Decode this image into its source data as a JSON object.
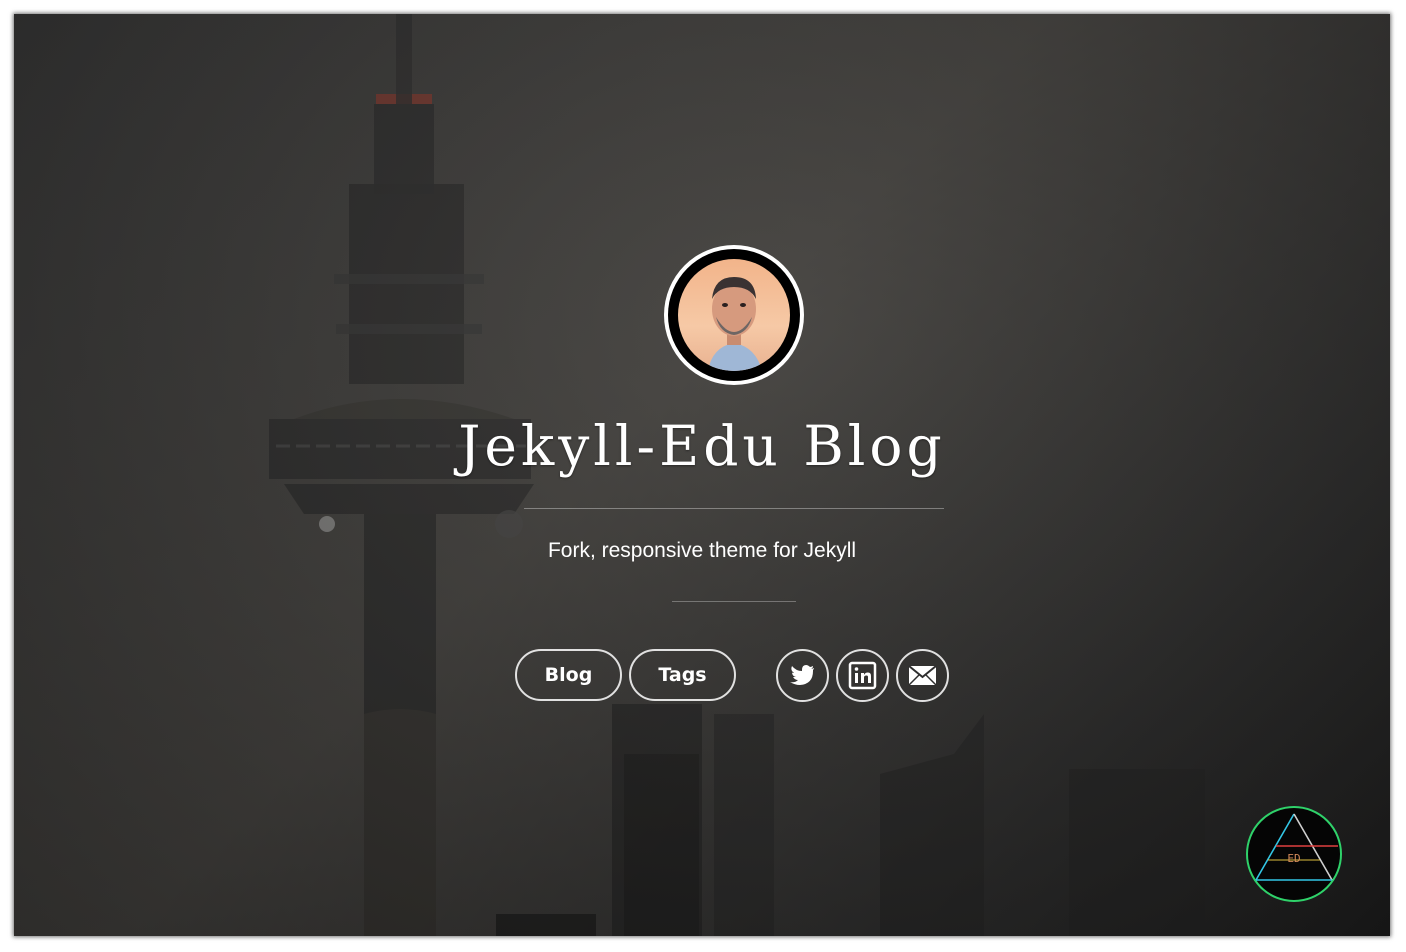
{
  "site": {
    "title": "Jekyll-Edu Blog",
    "tagline": "Fork, responsive theme for Jekyll"
  },
  "nav": {
    "buttons": [
      {
        "label": "Blog"
      },
      {
        "label": "Tags"
      }
    ]
  },
  "social": [
    {
      "icon": "twitter-icon"
    },
    {
      "icon": "linkedin-icon"
    },
    {
      "icon": "email-icon"
    }
  ],
  "badge": {
    "text": "ED"
  },
  "colors": {
    "text": "#ffffff",
    "badge_ring": "#2fd26a",
    "avatar_bg": "#f2b48a"
  }
}
